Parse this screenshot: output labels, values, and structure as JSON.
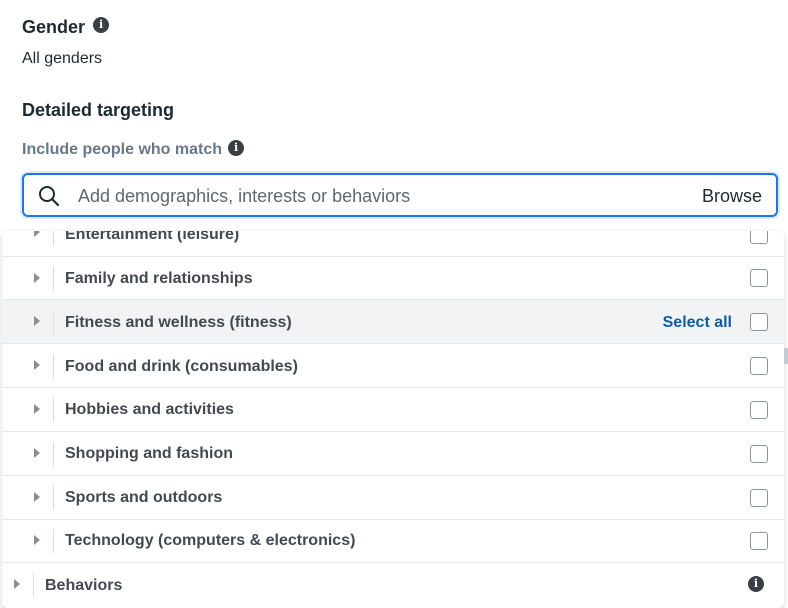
{
  "gender": {
    "title": "Gender",
    "value": "All genders"
  },
  "detailed_targeting": {
    "title": "Detailed targeting",
    "include_label": "Include people who match",
    "search": {
      "placeholder": "Add demographics, interests or behaviors",
      "browse_label": "Browse"
    }
  },
  "dropdown": {
    "select_all_label": "Select all",
    "items": [
      {
        "label": "Entertainment (leisure)"
      },
      {
        "label": "Family and relationships"
      },
      {
        "label": "Fitness and wellness (fitness)"
      },
      {
        "label": "Food and drink (consumables)"
      },
      {
        "label": "Hobbies and activities"
      },
      {
        "label": "Shopping and fashion"
      },
      {
        "label": "Sports and outdoors"
      },
      {
        "label": "Technology (computers & electronics)"
      }
    ],
    "behaviors_label": "Behaviors"
  }
}
